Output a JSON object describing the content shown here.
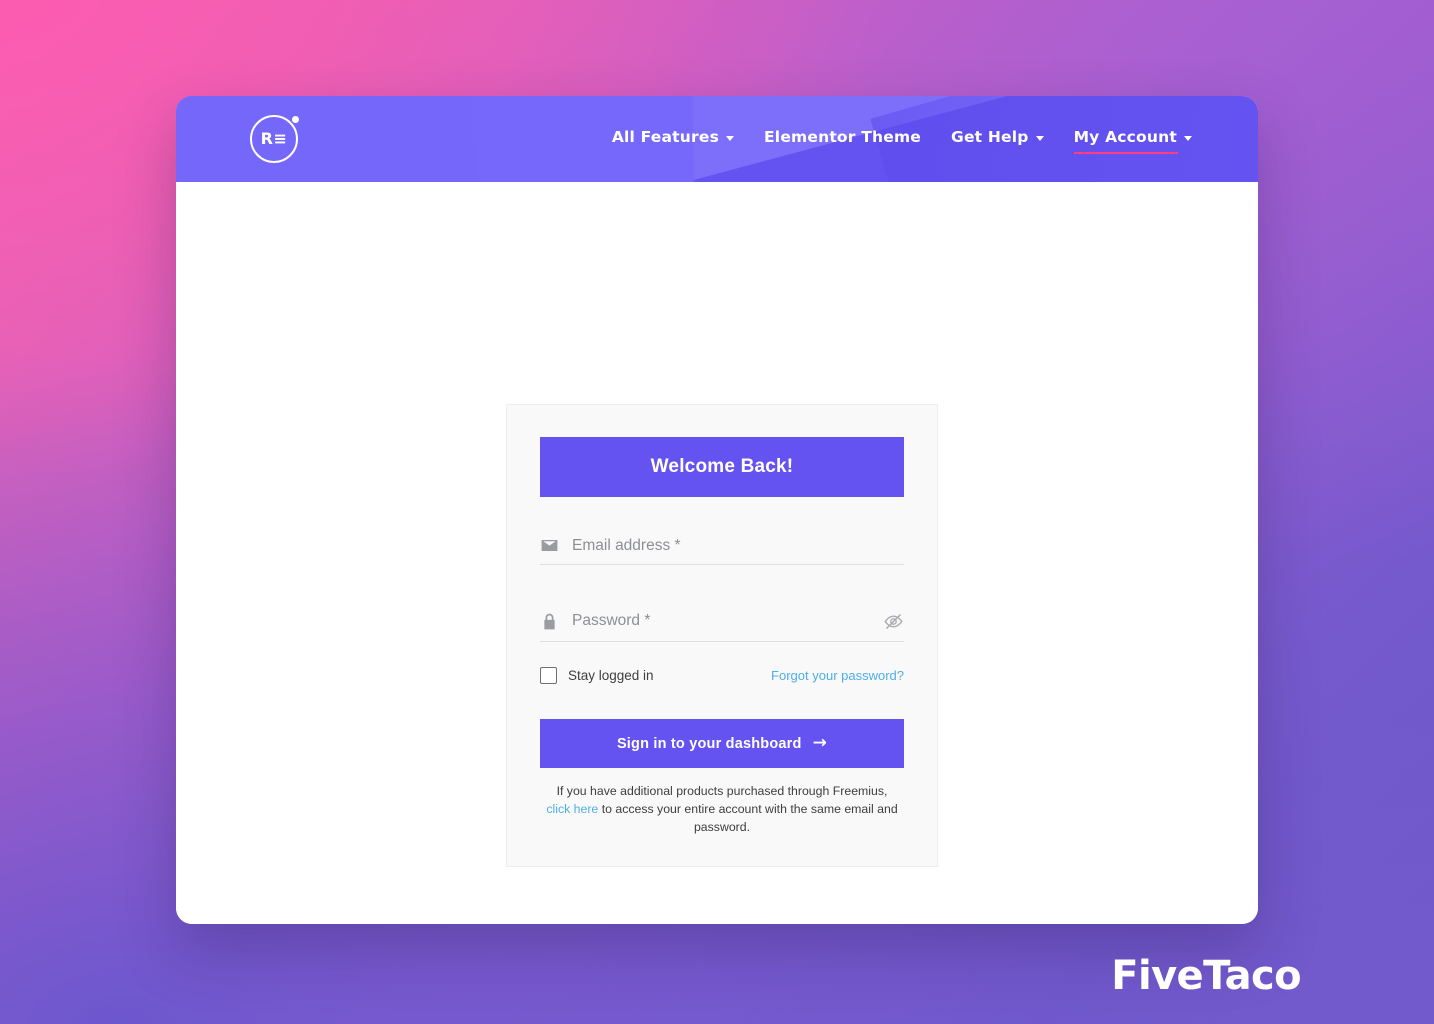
{
  "background": {
    "gradient_start": "#f263b4",
    "gradient_mid": "#a95fd0",
    "gradient_end": "#6a59cb"
  },
  "header": {
    "background_color": "#6453f0",
    "logo": {
      "icon": "re-circle-logo-icon",
      "mark": "R≡",
      "dot": "accent-dot-icon"
    },
    "nav": [
      {
        "label": "All Features",
        "has_caret": true,
        "active": false
      },
      {
        "label": "Elementor Theme",
        "has_caret": false,
        "active": false
      },
      {
        "label": "Get Help",
        "has_caret": true,
        "active": false
      },
      {
        "label": "My Account",
        "has_caret": true,
        "active": true
      }
    ],
    "active_underline_color": "#ff3e7f"
  },
  "login_card": {
    "title": "Welcome Back!",
    "title_background": "#6453f0",
    "card_background": "#f9f9fa",
    "email": {
      "icon": "envelope-icon",
      "placeholder": "Email address *",
      "value": ""
    },
    "password": {
      "icon": "lock-icon",
      "placeholder": "Password *",
      "value": "",
      "toggle_icon": "eye-off-icon"
    },
    "stay_logged_in": {
      "label": "Stay logged in",
      "checked": false
    },
    "forgot_password": {
      "label": "Forgot your password?",
      "color": "#4eaee8"
    },
    "submit": {
      "label": "Sign in to your dashboard",
      "arrow": "→",
      "background": "#6453f0"
    },
    "note": {
      "part1": "If you have additional products purchased through Freemius, ",
      "link": "click here",
      "part2": " to access your entire account with the same email and password."
    }
  },
  "watermark": {
    "text": "FiveTaco"
  }
}
